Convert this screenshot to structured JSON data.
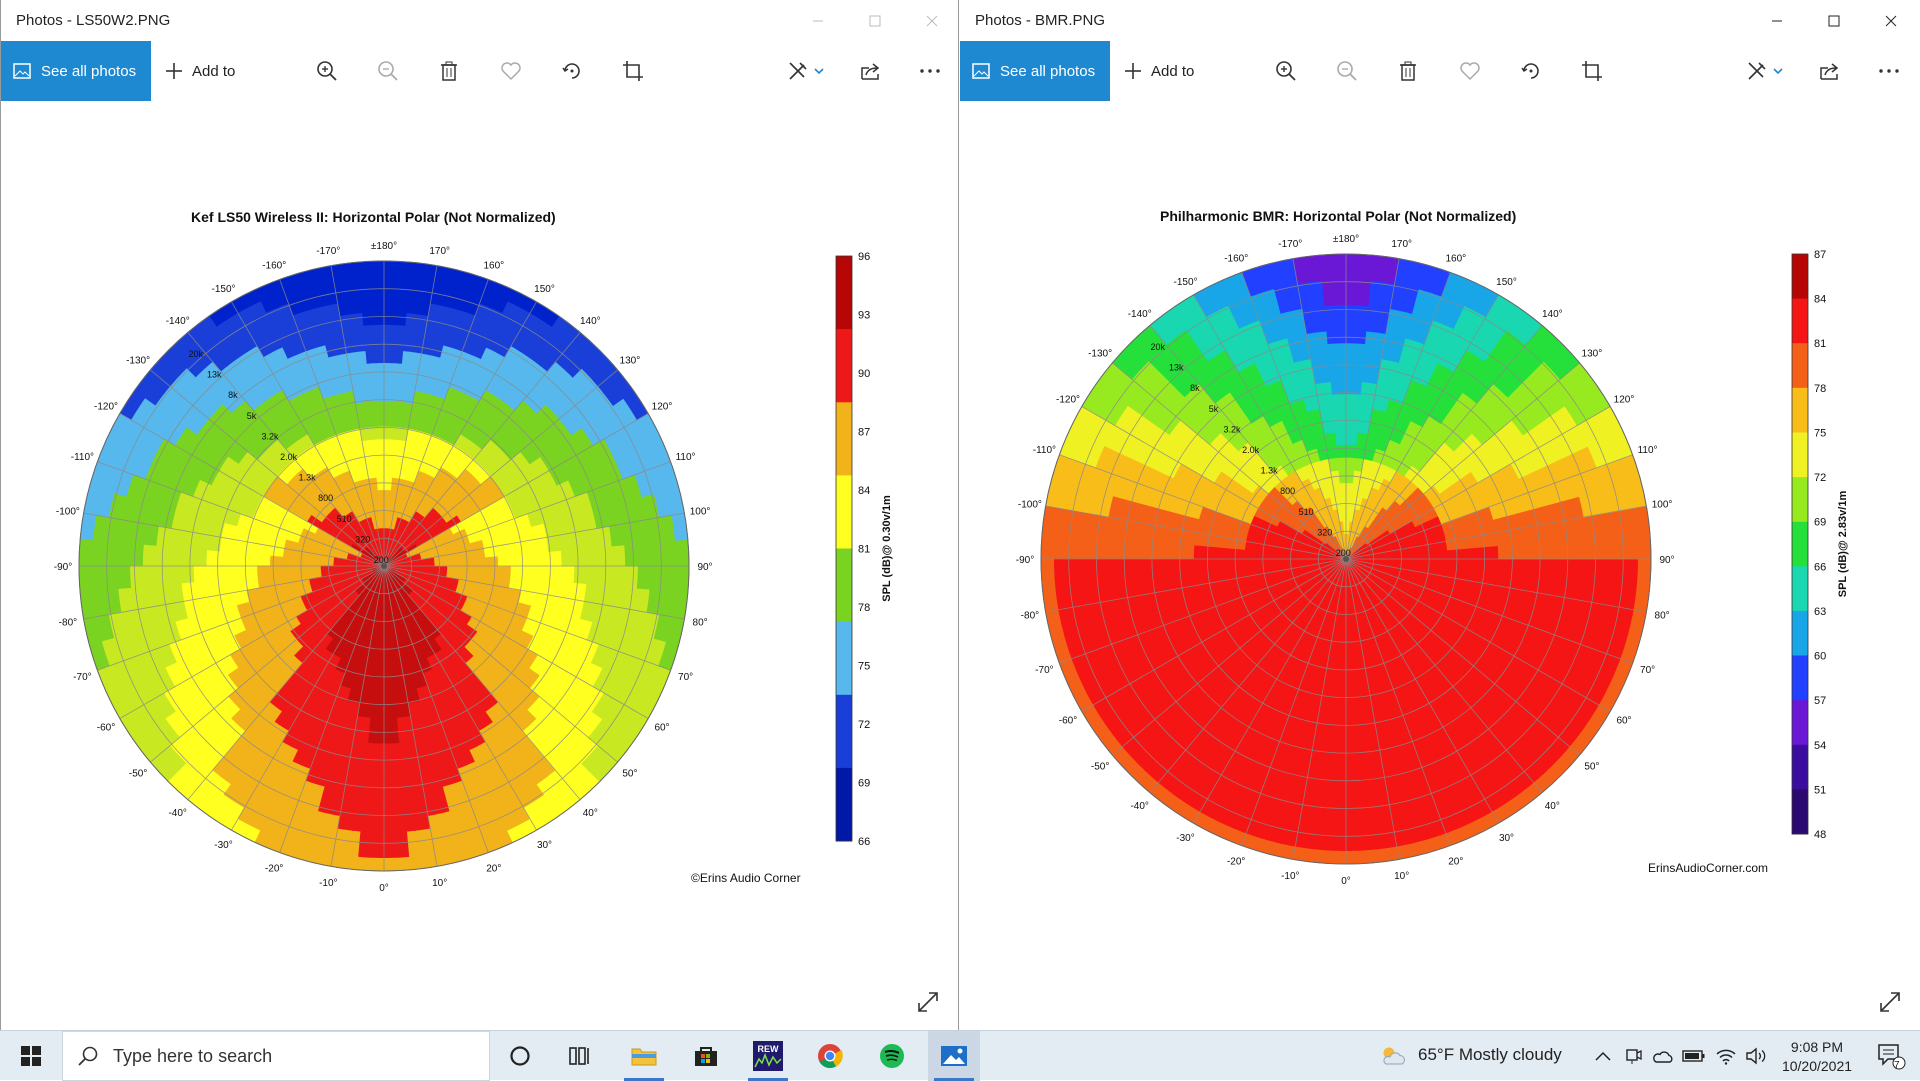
{
  "windows": [
    {
      "title": "Photos - LS50W2.PNG",
      "toolbar": {
        "see_all": "See all photos",
        "add_to": "Add to"
      },
      "chart": {
        "title": "Kef LS50 Wireless II: Horizontal Polar (Not Normalized)",
        "colorbar_ticks": [
          "96",
          "93",
          "90",
          "87",
          "84",
          "81",
          "78",
          "75",
          "72",
          "69",
          "66"
        ],
        "colorbar_label": "SPL (dB)@ 0.30v/1m",
        "watermark": "©Erins Audio Corner",
        "angle_labels": [
          "0°",
          "10°",
          "20°",
          "30°",
          "40°",
          "50°",
          "60°",
          "70°",
          "80°",
          "90°",
          "100°",
          "110°",
          "120°",
          "130°",
          "140°",
          "150°",
          "160°",
          "170°",
          "±180°",
          "-170°",
          "-160°",
          "-150°",
          "-140°",
          "-130°",
          "-120°",
          "-110°",
          "-100°",
          "-90°",
          "-80°",
          "-70°",
          "-60°",
          "-50°",
          "-40°",
          "-30°",
          "-20°",
          "-10°"
        ],
        "freq_labels": [
          "200",
          "320",
          "510",
          "800",
          "1.3k",
          "2.0k",
          "3.2k",
          "5k",
          "8k",
          "13k",
          "20k"
        ]
      }
    },
    {
      "title": "Photos - BMR.PNG",
      "toolbar": {
        "see_all": "See all photos",
        "add_to": "Add to"
      },
      "chart": {
        "title": "Philharmonic BMR: Horizontal Polar (Not Normalized)",
        "colorbar_ticks": [
          "87",
          "84",
          "81",
          "78",
          "75",
          "72",
          "69",
          "66",
          "63",
          "60",
          "57",
          "54",
          "51",
          "48"
        ],
        "colorbar_label": "SPL (dB)@ 2.83v/1m",
        "watermark": "ErinsAudioCorner.com",
        "angle_labels": [
          "0°",
          "10°",
          "20°",
          "30°",
          "40°",
          "50°",
          "60°",
          "70°",
          "80°",
          "90°",
          "100°",
          "110°",
          "120°",
          "130°",
          "140°",
          "150°",
          "160°",
          "170°",
          "±180°",
          "-170°",
          "-160°",
          "-150°",
          "-140°",
          "-130°",
          "-120°",
          "-110°",
          "-100°",
          "-90°",
          "-80°",
          "-70°",
          "-60°",
          "-50°",
          "-40°",
          "-30°",
          "-20°",
          "-10°"
        ],
        "freq_labels": [
          "200",
          "320",
          "510",
          "800",
          "1.3k",
          "2.0k",
          "3.2k",
          "5k",
          "8k",
          "13k",
          "20k"
        ]
      }
    }
  ],
  "taskbar": {
    "search_placeholder": "Type here to search",
    "weather": "65°F  Mostly cloudy",
    "time": "9:08 PM",
    "date": "10/20/2021",
    "notification_count": "7"
  },
  "chart_data": [
    {
      "type": "heatmap",
      "title": "Kef LS50 Wireless II: Horizontal Polar (Not Normalized)",
      "colorbar": {
        "label": "SPL (dB)@ 0.30v/1m",
        "min": 66,
        "max": 96,
        "ticks": [
          96,
          93,
          90,
          87,
          84,
          81,
          78,
          75,
          72,
          69,
          66
        ]
      },
      "angles": [
        "0°",
        "±10°",
        "±20°",
        "...",
        "±180°"
      ],
      "radial_frequencies": [
        "200",
        "320",
        "510",
        "800",
        "1.3k",
        "2.0k",
        "3.2k",
        "5k",
        "8k",
        "13k",
        "20k"
      ]
    },
    {
      "type": "heatmap",
      "title": "Philharmonic BMR: Horizontal Polar (Not Normalized)",
      "colorbar": {
        "label": "SPL (dB)@ 2.83v/1m",
        "min": 48,
        "max": 87,
        "ticks": [
          87,
          84,
          81,
          78,
          75,
          72,
          69,
          66,
          63,
          60,
          57,
          54,
          51,
          48
        ]
      },
      "angles": [
        "0°",
        "±10°",
        "±20°",
        "...",
        "±180°"
      ],
      "radial_frequencies": [
        "200",
        "320",
        "510",
        "800",
        "1.3k",
        "2.0k",
        "3.2k",
        "5k",
        "8k",
        "13k",
        "20k"
      ]
    }
  ]
}
